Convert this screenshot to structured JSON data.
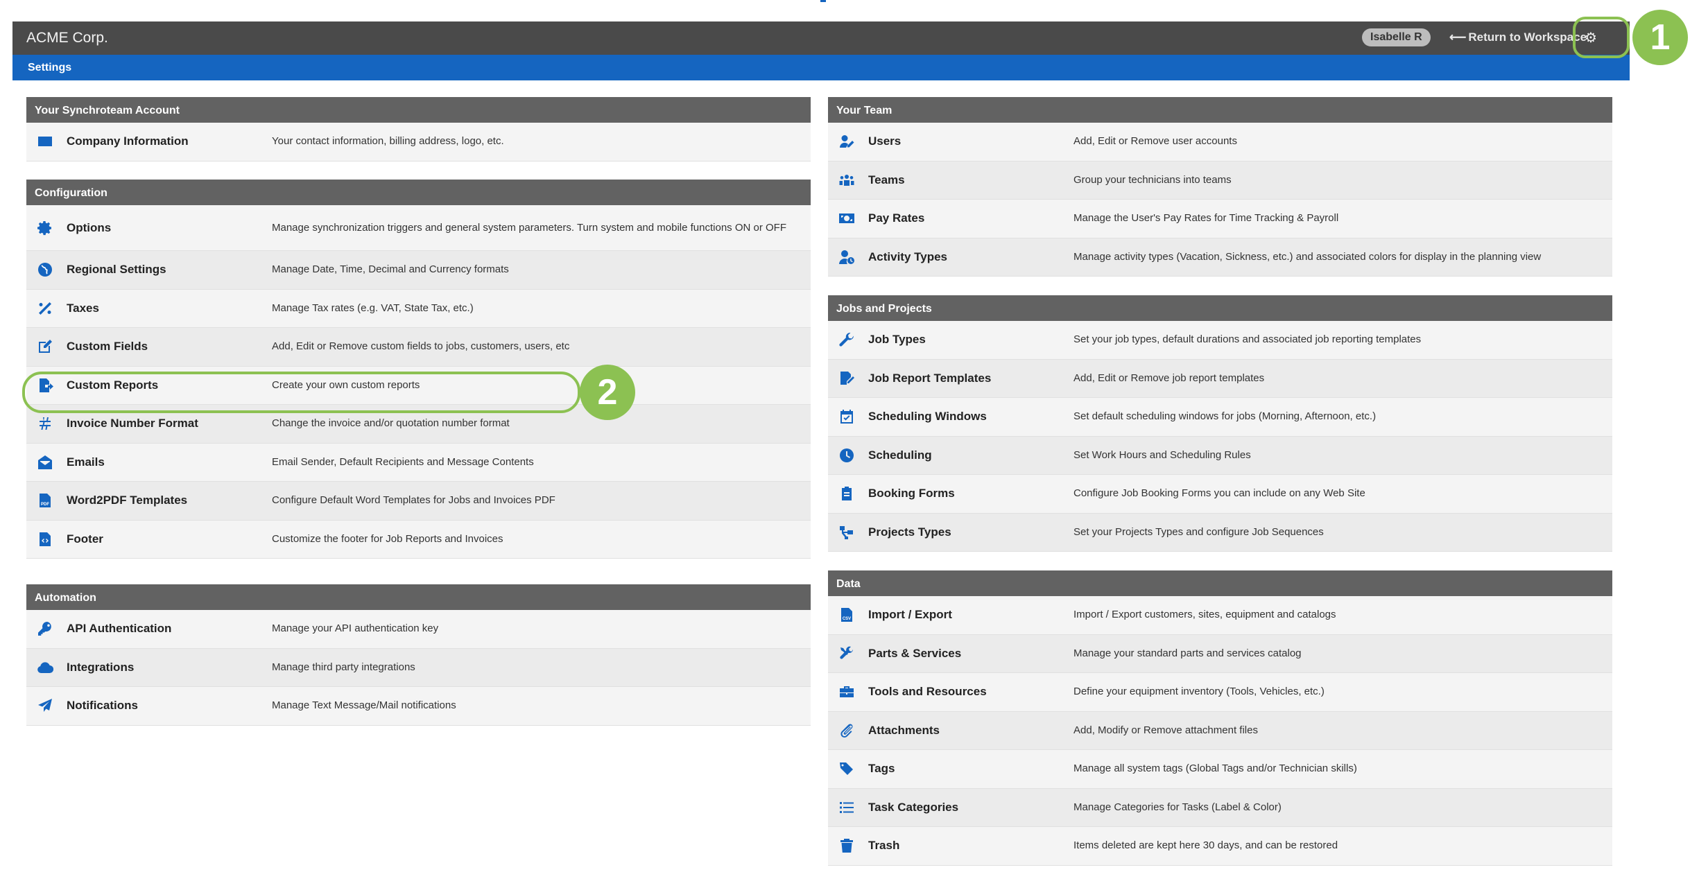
{
  "header": {
    "brand": "ACME Corp.",
    "user": "Isabelle R",
    "return_arrow": "⟵",
    "return_label": "Return to Workspace",
    "settings_icon": "gear-icon"
  },
  "subheader": {
    "title": "Settings"
  },
  "callouts": [
    "1",
    "2"
  ],
  "colors": {
    "accent": "#1565c0",
    "highlight": "#8cc152",
    "header": "#4a4a4a",
    "section": "#626262"
  },
  "sections": {
    "account": {
      "title": "Your Synchroteam Account",
      "items": [
        {
          "icon": "id-card-icon",
          "title": "Company Information",
          "desc": "Your contact information, billing address, logo, etc."
        }
      ]
    },
    "configuration": {
      "title": "Configuration",
      "items": [
        {
          "icon": "gear-icon",
          "title": "Options",
          "desc": "Manage synchronization triggers and general system parameters. Turn system and mobile functions ON or OFF"
        },
        {
          "icon": "globe-icon",
          "title": "Regional Settings",
          "desc": "Manage Date, Time, Decimal and Currency formats"
        },
        {
          "icon": "percent-icon",
          "title": "Taxes",
          "desc": "Manage Tax rates (e.g. VAT, State Tax, etc.)"
        },
        {
          "icon": "edit-icon",
          "title": "Custom Fields",
          "desc": "Add, Edit or Remove custom fields to jobs, customers, users, etc"
        },
        {
          "icon": "file-export-icon",
          "title": "Custom Reports",
          "desc": "Create your own custom reports"
        },
        {
          "icon": "hashtag-icon",
          "title": "Invoice Number Format",
          "desc": "Change the invoice and/or quotation number format"
        },
        {
          "icon": "envelope-open-icon",
          "title": "Emails",
          "desc": "Email Sender, Default Recipients and Message Contents"
        },
        {
          "icon": "pdf-file-icon",
          "title": "Word2PDF Templates",
          "desc": "Configure Default Word Templates for Jobs and Invoices PDF"
        },
        {
          "icon": "file-code-icon",
          "title": "Footer",
          "desc": "Customize the footer for Job Reports and Invoices"
        }
      ]
    },
    "automation": {
      "title": "Automation",
      "items": [
        {
          "icon": "key-icon",
          "title": "API Authentication",
          "desc": "Manage your API authentication key"
        },
        {
          "icon": "cloud-icon",
          "title": "Integrations",
          "desc": "Manage third party integrations"
        },
        {
          "icon": "paper-plane-icon",
          "title": "Notifications",
          "desc": "Manage Text Message/Mail notifications"
        }
      ]
    },
    "team": {
      "title": "Your Team",
      "items": [
        {
          "icon": "user-edit-icon",
          "title": "Users",
          "desc": "Add, Edit or Remove user accounts"
        },
        {
          "icon": "users-icon",
          "title": "Teams",
          "desc": "Group your technicians into teams"
        },
        {
          "icon": "money-bill-icon",
          "title": "Pay Rates",
          "desc": "Manage the User's Pay Rates for Time Tracking & Payroll"
        },
        {
          "icon": "user-clock-icon",
          "title": "Activity Types",
          "desc": "Manage activity types (Vacation, Sickness, etc.) and associated colors for display in the planning view"
        }
      ]
    },
    "jobs": {
      "title": "Jobs and Projects",
      "items": [
        {
          "icon": "wrench-icon",
          "title": "Job Types",
          "desc": "Set your job types, default durations and associated job reporting templates"
        },
        {
          "icon": "file-signature-icon",
          "title": "Job Report Templates",
          "desc": "Add, Edit or Remove job report templates"
        },
        {
          "icon": "calendar-check-icon",
          "title": "Scheduling Windows",
          "desc": "Set default scheduling windows for jobs (Morning, Afternoon, etc.)"
        },
        {
          "icon": "clock-icon",
          "title": "Scheduling",
          "desc": "Set Work Hours and Scheduling Rules"
        },
        {
          "icon": "clipboard-icon",
          "title": "Booking Forms",
          "desc": "Configure Job Booking Forms you can include on any Web Site"
        },
        {
          "icon": "project-diagram-icon",
          "title": "Projects Types",
          "desc": "Set your Projects Types and configure Job Sequences"
        }
      ]
    },
    "data": {
      "title": "Data",
      "items": [
        {
          "icon": "csv-file-icon",
          "title": "Import / Export",
          "desc": "Import / Export customers, sites, equipment and catalogs"
        },
        {
          "icon": "tools-icon",
          "title": "Parts & Services",
          "desc": "Manage your standard parts and services catalog"
        },
        {
          "icon": "toolbox-icon",
          "title": "Tools and Resources",
          "desc": "Define your equipment inventory (Tools, Vehicles, etc.)"
        },
        {
          "icon": "paperclip-icon",
          "title": "Attachments",
          "desc": "Add, Modify or Remove attachment files"
        },
        {
          "icon": "tags-icon",
          "title": "Tags",
          "desc": "Manage all system tags (Global Tags and/or Technician skills)"
        },
        {
          "icon": "list-icon",
          "title": "Task Categories",
          "desc": "Manage Categories for Tasks (Label & Color)"
        },
        {
          "icon": "trash-icon",
          "title": "Trash",
          "desc": "Items deleted are kept here 30 days, and can be restored"
        }
      ]
    }
  }
}
